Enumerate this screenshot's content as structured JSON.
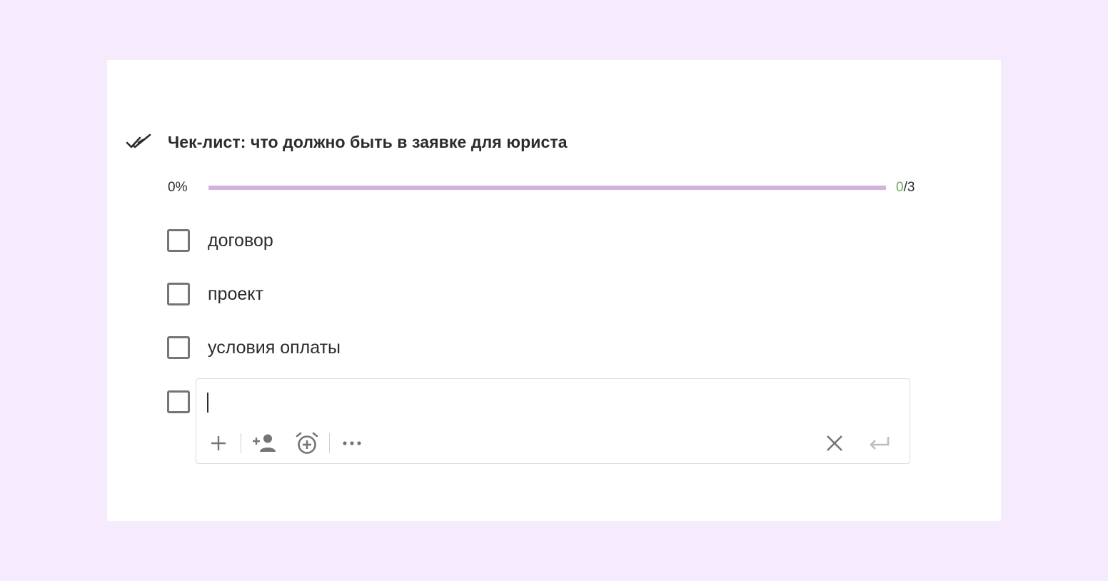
{
  "checklist": {
    "title": "Чек-лист: что должно быть в заявке для юриста",
    "progress": {
      "percent_label": "0%",
      "completed": "0",
      "separator": "/",
      "total": "3",
      "fraction": 0
    },
    "items": [
      {
        "label": "договор",
        "checked": false
      },
      {
        "label": "проект",
        "checked": false
      },
      {
        "label": "условия оплаты",
        "checked": false
      }
    ],
    "new_item": {
      "value": "",
      "checked": false
    }
  },
  "toolbar": {
    "icons": [
      "plus-icon",
      "assign-person-icon",
      "alarm-add-icon",
      "more-icon",
      "close-icon",
      "enter-icon"
    ]
  },
  "colors": {
    "background": "#f5ebfd",
    "progress_track": "#d4b1e0",
    "completed_count": "#6aab5a",
    "checkbox_border": "#757575"
  }
}
